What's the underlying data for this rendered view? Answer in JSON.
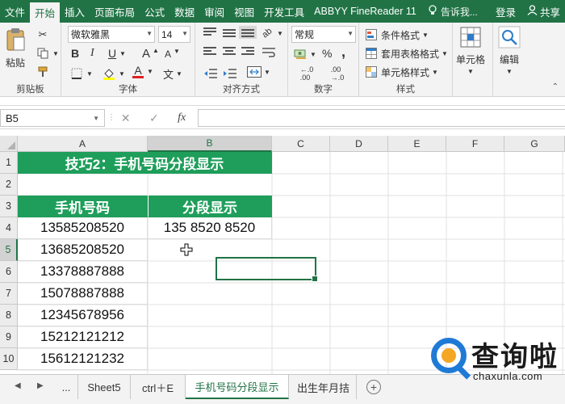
{
  "ribbon_tabs": [
    "文件",
    "开始",
    "插入",
    "页面布局",
    "公式",
    "数据",
    "审阅",
    "视图",
    "开发工具",
    "ABBYY FineReader 11"
  ],
  "active_tab_index": 1,
  "tell_me": "告诉我...",
  "login": "登录",
  "share": "共享",
  "clipboard": {
    "paste": "粘贴",
    "label": "剪贴板"
  },
  "font": {
    "name": "微软雅黑",
    "size": "14",
    "label": "字体",
    "bold": "B",
    "italic": "I",
    "underline": "U",
    "grow": "A",
    "shrink": "A",
    "color_a": "A",
    "wen": "文"
  },
  "alignment": {
    "label": "对齐方式"
  },
  "number": {
    "format": "常规",
    "label": "数字",
    "percent": "%",
    "comma": ","
  },
  "styles": {
    "conditional": "条件格式",
    "table": "套用表格格式",
    "cell": "单元格样式",
    "label": "样式"
  },
  "cells_group": {
    "label": "单元格"
  },
  "editing_group": {
    "label": "编辑"
  },
  "formula_bar": {
    "name_box": "B5",
    "formula": "",
    "fx": "fx"
  },
  "columns": [
    "A",
    "B",
    "C",
    "D",
    "E",
    "F",
    "G"
  ],
  "rows": [
    "1",
    "2",
    "3",
    "4",
    "5",
    "6",
    "7",
    "8",
    "9",
    "10"
  ],
  "sheet": {
    "title": "技巧2：手机号码分段显示",
    "header_a": "手机号码",
    "header_b": "分段显示",
    "phones": [
      "13585208520",
      "13685208520",
      "13378887888",
      "15078887888",
      "12345678956",
      "15212121212",
      "15612121232"
    ],
    "segmented": "135 8520 8520"
  },
  "sheet_tabs": [
    "...",
    "Sheet5",
    "ctrl＋E",
    "手机号码分段显示",
    "出生年月拮"
  ],
  "active_sheet_index": 3,
  "watermark": {
    "cn": "查询啦",
    "en": "chaxunla.com"
  },
  "accent_color": "#217346",
  "header_fill": "#1e9e5a"
}
